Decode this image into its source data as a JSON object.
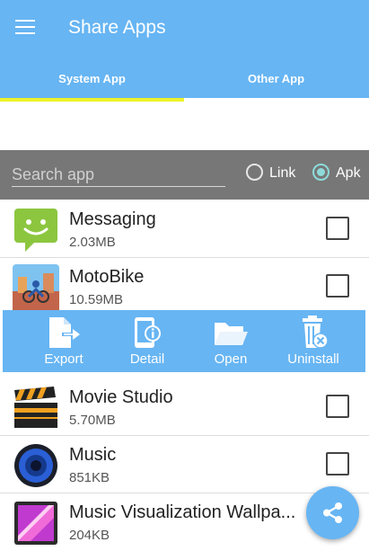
{
  "header": {
    "title": "Share Apps",
    "menu_icon": "hamburger-icon"
  },
  "tabs": [
    {
      "label": "System App",
      "selected": true
    },
    {
      "label": "Other App",
      "selected": false
    }
  ],
  "search": {
    "placeholder": "Search app",
    "value": ""
  },
  "filter": {
    "options": [
      {
        "label": "Link",
        "checked": false
      },
      {
        "label": "Apk",
        "checked": true
      }
    ]
  },
  "apps": [
    {
      "name": "Messaging",
      "size": "2.03MB",
      "icon": "messaging-icon",
      "checked": false
    },
    {
      "name": "MotoBike",
      "size": "10.59MB",
      "icon": "motobike-icon",
      "checked": false
    },
    {
      "name": "Movie Studio",
      "size": "5.70MB",
      "icon": "clapperboard-icon",
      "checked": false
    },
    {
      "name": "Music",
      "size": "851KB",
      "icon": "speaker-icon",
      "checked": false
    },
    {
      "name": "Music Visualization Wallpa...",
      "size": "204KB",
      "icon": "visualization-icon",
      "checked": false
    }
  ],
  "actions": [
    {
      "label": "Export",
      "icon": "export-icon"
    },
    {
      "label": "Detail",
      "icon": "detail-icon"
    },
    {
      "label": "Open",
      "icon": "folder-open-icon"
    },
    {
      "label": "Uninstall",
      "icon": "trash-icon"
    }
  ],
  "fab": {
    "icon": "share-icon"
  },
  "colors": {
    "primary": "#67b5f3",
    "tab_indicator": "#eef22a",
    "search_bar": "#777777",
    "radio_accent": "#8edada"
  }
}
